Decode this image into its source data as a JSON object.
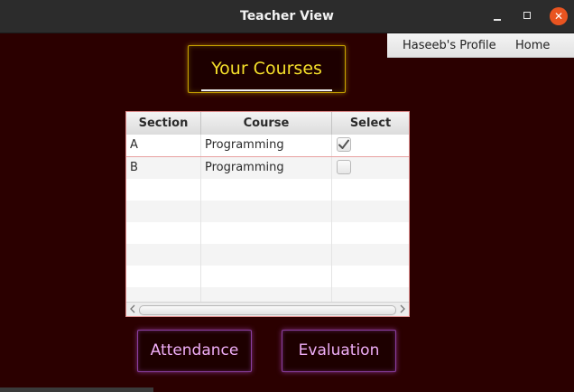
{
  "window": {
    "title": "Teacher View",
    "minimize_symbol": "",
    "maximize_symbol": "",
    "close_symbol": "✕"
  },
  "menu": {
    "items": [
      {
        "label": "Haseeb's Profile"
      },
      {
        "label": "Home"
      }
    ]
  },
  "header": {
    "label": "Your Courses",
    "color": "#f5df2a",
    "border_color": "#c9a400"
  },
  "table": {
    "columns": [
      "Section",
      "Course",
      "Select"
    ],
    "rows": [
      {
        "section": "A",
        "course": "Programming",
        "selected": true
      },
      {
        "section": "B",
        "course": "Programming",
        "selected": false
      }
    ],
    "empty_rows": 6
  },
  "actions": {
    "attendance_label": "Attendance",
    "evaluation_label": "Evaluation",
    "color": "#f0aef8",
    "border_color": "#8a3fa0"
  },
  "colors": {
    "background": "#2b0000",
    "titlebar": "#2c2c2c",
    "close_button": "#e95420",
    "table_border": "#e08b8b"
  },
  "icons": {
    "minimize": "minimize-icon",
    "maximize": "maximize-icon",
    "close": "close-icon",
    "check": "checkmark-icon",
    "scroll_left": "chevron-left-icon",
    "scroll_right": "chevron-right-icon"
  }
}
